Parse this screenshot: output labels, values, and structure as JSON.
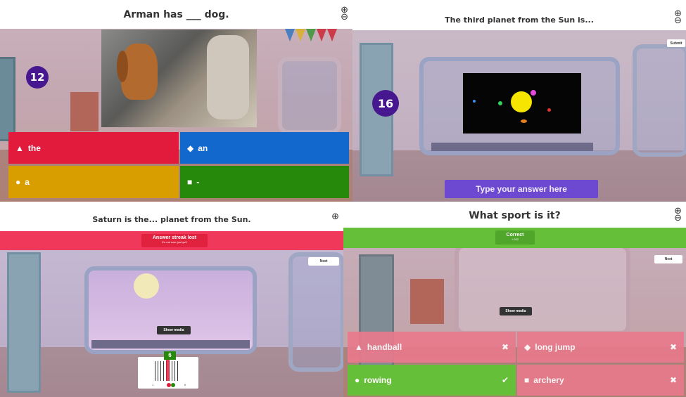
{
  "panel1": {
    "question": "Arman has ___ dog.",
    "timer": "12",
    "answers": [
      {
        "symbol": "▲",
        "label": "the",
        "color": "#e21b3c"
      },
      {
        "symbol": "◆",
        "label": "an",
        "color": "#1368ce"
      },
      {
        "symbol": "●",
        "label": "a",
        "color": "#d89e00"
      },
      {
        "symbol": "■",
        "label": "-",
        "color": "#26890c"
      }
    ]
  },
  "panel2": {
    "question": "The third planet from the Sun is...",
    "timer": "16",
    "submit_label": "Submit",
    "answer_placeholder": "Type your answer here"
  },
  "panel3": {
    "question": "Saturn is the... planet from the Sun.",
    "banner_title": "Answer streak lost",
    "banner_subtitle": "It's not over just yet!",
    "next_label": "Next",
    "show_media_label": "Show media",
    "result_count": "6",
    "slider_min": "1",
    "slider_max": "8"
  },
  "panel4": {
    "question": "What sport is it?",
    "banner_title": "Correct",
    "banner_points": "+ 632",
    "next_label": "Next",
    "show_media_label": "Show media",
    "answers": [
      {
        "symbol": "▲",
        "label": "handball",
        "mark": "✖",
        "color": "#e87a8c"
      },
      {
        "symbol": "◆",
        "label": "long jump",
        "mark": "✖",
        "color": "#e87a8c"
      },
      {
        "symbol": "●",
        "label": "rowing",
        "mark": "✔",
        "color": "#66bf39"
      },
      {
        "symbol": "■",
        "label": "archery",
        "mark": "✖",
        "color": "#e87a8c"
      }
    ]
  },
  "icons": {
    "corner_controls": "⊕"
  }
}
